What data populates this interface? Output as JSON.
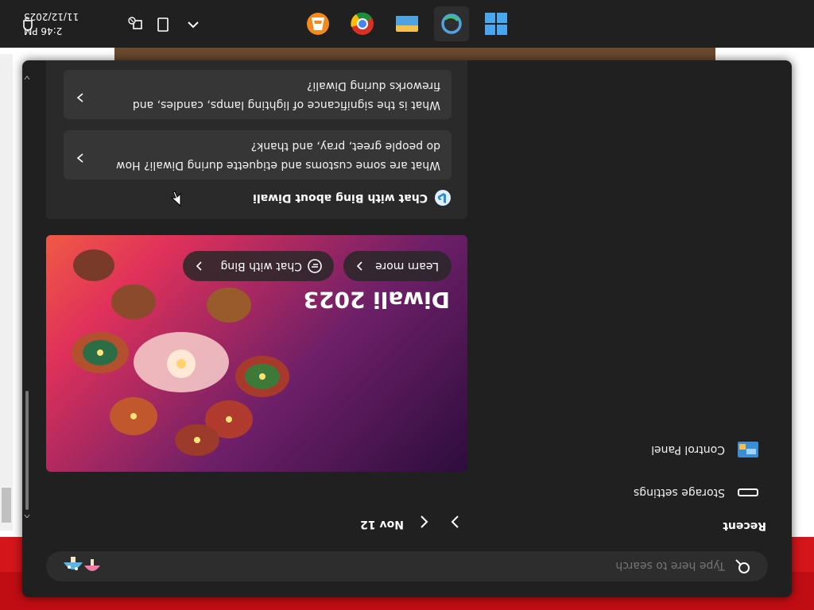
{
  "search": {
    "placeholder": "Type here to search"
  },
  "recent": {
    "label": "Recent",
    "items": [
      {
        "label": "Storage settings",
        "icon": "storage-icon"
      },
      {
        "label": "Control Panel",
        "icon": "control-panel-icon"
      }
    ]
  },
  "highlights": {
    "date": "Nov 12",
    "more_label": "...",
    "hero": {
      "title": "Diwali 2023",
      "learn_more": "Learn more",
      "chat_with_bing": "Chat with Bing"
    }
  },
  "chat": {
    "header": "Chat with Bing about Diwali",
    "suggestions": [
      "What are some customs and etiquette during Diwali? How do people greet, pray, and thank?",
      "What is the significance of lighting lamps, candles, and fireworks during Diwali?"
    ]
  },
  "clock": {
    "time": "2:46 PM",
    "date": "11/12/2023"
  },
  "colors": {
    "panel": "#202020",
    "accent": "#4fa3e0",
    "banner_red": "#c00d13"
  },
  "taskbar_apps": [
    "start-icon",
    "cortana-icon",
    "file-explorer-icon",
    "chrome-icon",
    "vlc-icon"
  ]
}
